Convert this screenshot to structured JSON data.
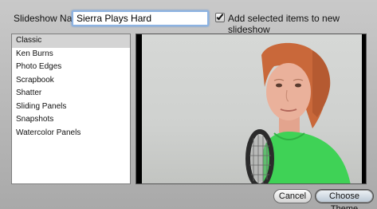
{
  "dialog": {
    "name_label": "Slideshow Name:",
    "name_value": "Sierra Plays Hard",
    "add_items_label": "Add selected items to new slideshow",
    "add_items_checked": true
  },
  "themes": {
    "selected": "Classic",
    "items": [
      "Classic",
      "Ken Burns",
      "Photo Edges",
      "Scrapbook",
      "Shatter",
      "Sliding Panels",
      "Snapshots",
      "Watercolor Panels"
    ]
  },
  "buttons": {
    "cancel": "Cancel",
    "choose": "Choose Theme"
  },
  "colors": {
    "selection": "#d4d4d4",
    "shirt": "#3fd256",
    "hair": "#c9683a",
    "focus_ring": "#8db3e2"
  }
}
